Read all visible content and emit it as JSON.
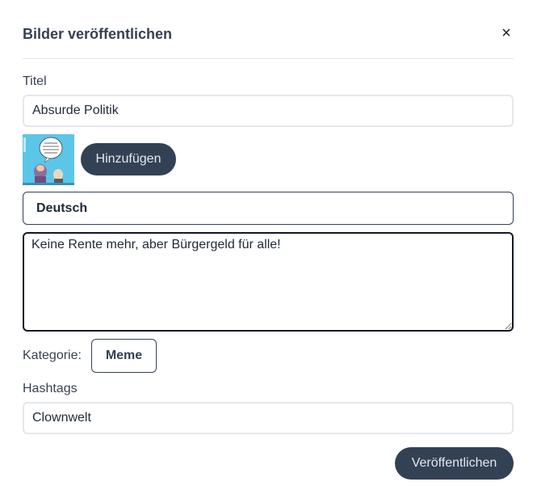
{
  "dialog": {
    "title": "Bilder veröffentlichen",
    "close_symbol": "×"
  },
  "form": {
    "title_label": "Titel",
    "title_value": "Absurde Politik",
    "add_image_label": "Hinzufügen",
    "language_selected": "Deutsch",
    "text_value": "Keine Rente mehr, aber Bürgergeld für alle!",
    "category_label": "Kategorie:",
    "category_value": "Meme",
    "hashtags_label": "Hashtags",
    "hashtags_value": "Clownwelt",
    "publish_label": "Veröffentlichen"
  },
  "colors": {
    "primary": "#334155",
    "border": "#e5e7eb",
    "thumbnail_bg": "#5bc6e8"
  }
}
